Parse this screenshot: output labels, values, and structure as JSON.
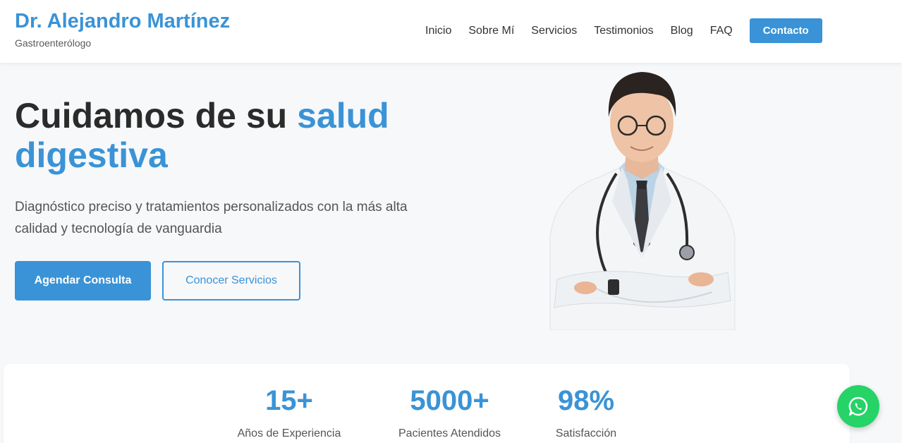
{
  "brand": {
    "name": "Dr. Alejandro Martínez",
    "subtitle": "Gastroenterólogo"
  },
  "nav": {
    "items": [
      "Inicio",
      "Sobre Mí",
      "Servicios",
      "Testimonios",
      "Blog",
      "FAQ"
    ],
    "cta": "Contacto"
  },
  "hero": {
    "title_part1": "Cuidamos de su ",
    "title_accent": "salud digestiva",
    "description": "Diagnóstico preciso y tratamientos personalizados con la más alta calidad y tecnología de vanguardia",
    "primary_button": "Agendar Consulta",
    "secondary_button": "Conocer Servicios"
  },
  "stats": [
    {
      "value": "15+",
      "label": "Años de Experiencia"
    },
    {
      "value": "5000+",
      "label": "Pacientes Atendidos"
    },
    {
      "value": "98%",
      "label": "Satisfacción"
    }
  ],
  "icons": {
    "whatsapp": "whatsapp-icon"
  },
  "colors": {
    "accent": "#3a93d6",
    "whatsapp": "#25d366",
    "background": "#f7f8fa"
  }
}
